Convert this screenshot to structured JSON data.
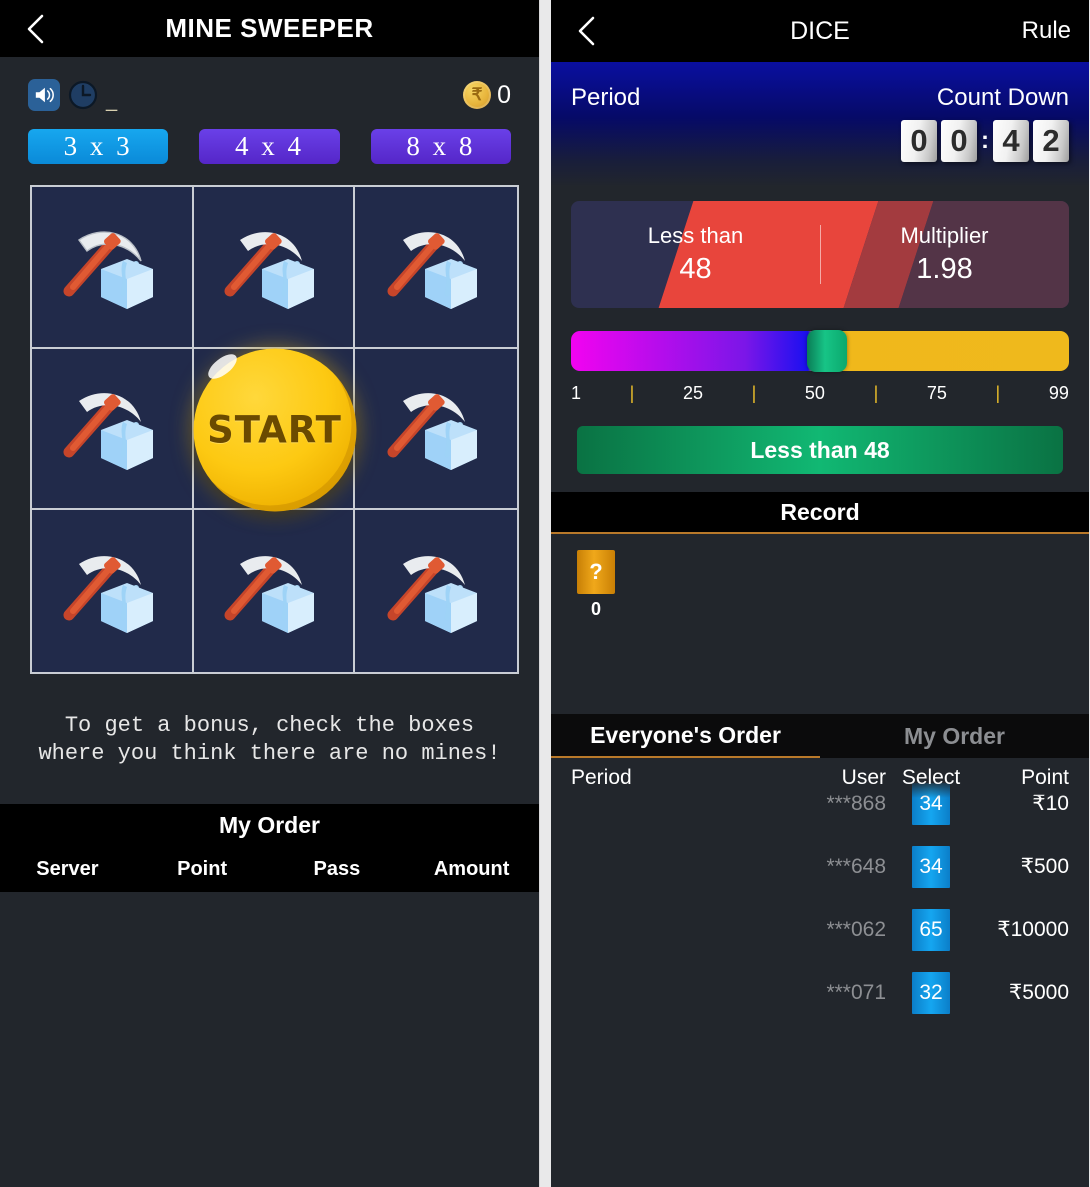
{
  "mine": {
    "nav": {
      "back_icon": "chevron-left-icon",
      "title": "MINE SWEEPER"
    },
    "toolbar": {
      "sound_icon": "speaker-icon",
      "history_icon": "clock-icon",
      "dash": "_",
      "coin_icon": "rupee-coin-icon",
      "coin_symbol": "₹",
      "balance": "0"
    },
    "sizes": [
      {
        "label": "3 x 3",
        "state": "active"
      },
      {
        "label": "4 x 4",
        "state": "idle"
      },
      {
        "label": "8 x 8",
        "state": "idle"
      }
    ],
    "grid": {
      "rows": 3,
      "cols": 3,
      "cell_icon": "pickaxe-ice-cube-icon",
      "start_label": "START"
    },
    "hint": "To get a bonus, check the boxes where you think there are no mines!",
    "order": {
      "title": "My Order",
      "columns": [
        "Server",
        "Point",
        "Pass",
        "Amount"
      ],
      "rows": []
    }
  },
  "dice": {
    "nav": {
      "back_icon": "chevron-left-icon",
      "title": "DICE",
      "rule_label": "Rule"
    },
    "hero": {
      "period_label": "Period",
      "period_value": "",
      "countdown_label": "Count Down",
      "countdown_digits": [
        "0",
        "0",
        "4",
        "2"
      ],
      "countdown_separator": ":"
    },
    "bet_card": {
      "left_label": "Less than",
      "left_value": "48",
      "right_label": "Multiplier",
      "right_value": "1.98"
    },
    "slider": {
      "value": 48,
      "min": 1,
      "max": 99,
      "ticks": [
        "1",
        "|",
        "25",
        "|",
        "50",
        "|",
        "75",
        "|",
        "99"
      ]
    },
    "bet_button": "Less than 48",
    "record": {
      "title": "Record",
      "items": [
        {
          "badge": "?",
          "value": "0"
        }
      ]
    },
    "order": {
      "tabs": [
        {
          "label": "Everyone's Order",
          "state": "active"
        },
        {
          "label": "My Order",
          "state": "inactive"
        }
      ],
      "columns": [
        "Period",
        "User",
        "Select",
        "Point"
      ],
      "rows": [
        {
          "period": "",
          "user": "***868",
          "select": "34",
          "point": "₹10"
        },
        {
          "period": "",
          "user": "***648",
          "select": "34",
          "point": "₹500"
        },
        {
          "period": "",
          "user": "***062",
          "select": "65",
          "point": "₹10000"
        },
        {
          "period": "",
          "user": "***071",
          "select": "32",
          "point": "₹5000"
        }
      ]
    }
  },
  "colors": {
    "panel_bg": "#22262c",
    "bar_black": "#000000",
    "accent_orange": "#b9792a",
    "active_blue": "#17a7ef",
    "idle_purple": "#6a40e8",
    "green": "#11b873",
    "gold": "#f0a81a",
    "cell_navy": "#212a4a"
  }
}
